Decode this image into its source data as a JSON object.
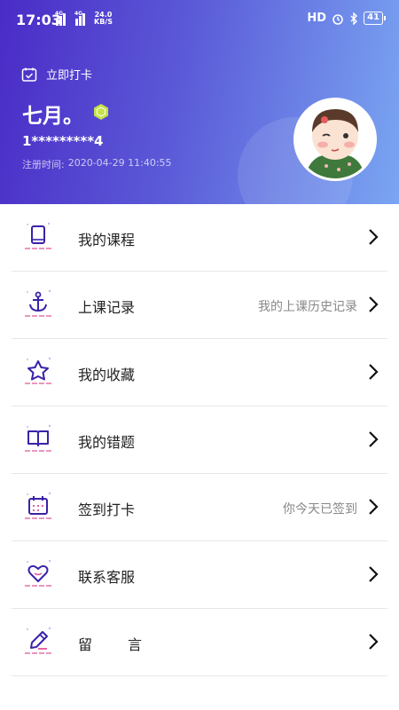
{
  "status_bar": {
    "time": "17:03",
    "signal1": "4G",
    "signal2": "4G",
    "net_speed_value": "24.0",
    "net_speed_unit": "KB/S",
    "hd": "HD",
    "battery": "41"
  },
  "header": {
    "checkin_label": "立即打卡",
    "user_name": "七月。",
    "phone": "1*********4",
    "reg_label": "注册时间:",
    "reg_time": "2020-04-29 11:40:55",
    "gradient_start": "#4a2bc6",
    "gradient_end": "#7aa6f2"
  },
  "menu": {
    "items": [
      {
        "label": "我的课程",
        "sub": "",
        "icon": "book-icon"
      },
      {
        "label": "上课记录",
        "sub": "我的上课历史记录",
        "icon": "anchor-icon"
      },
      {
        "label": "我的收藏",
        "sub": "",
        "icon": "star-icon"
      },
      {
        "label": "我的错题",
        "sub": "",
        "icon": "open-book-icon"
      },
      {
        "label": "签到打卡",
        "sub": "你今天已签到",
        "icon": "calendar-icon"
      },
      {
        "label": "联系客服",
        "sub": "",
        "icon": "heart-icon"
      },
      {
        "label": "留言",
        "sub": "",
        "icon": "pen-icon"
      }
    ]
  },
  "colors": {
    "icon_stroke": "#3b22a8",
    "icon_accent": "#e0569a"
  }
}
